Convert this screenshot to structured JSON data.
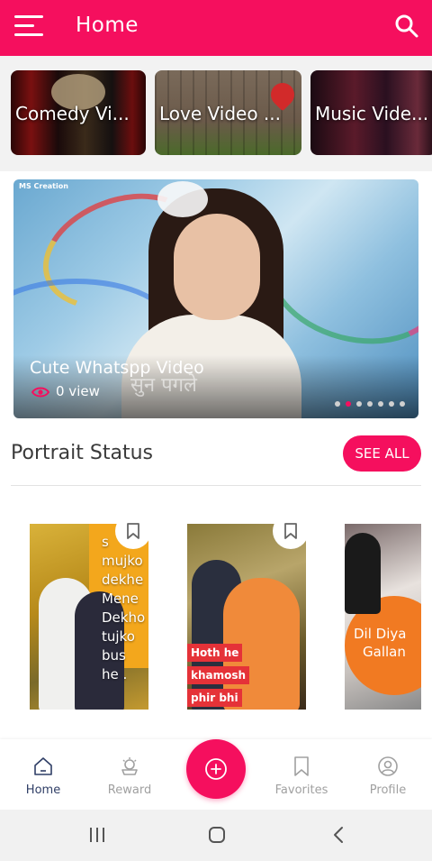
{
  "header": {
    "title": "Home"
  },
  "categories": [
    {
      "label": "Comedy Vi..."
    },
    {
      "label": "Love Video ..."
    },
    {
      "label": "Music Vide..."
    }
  ],
  "featured": {
    "credit": "MS Creation",
    "title": "Cute Whatspp Video",
    "views": "0 view",
    "overlay_text": "सुन पगले",
    "page_count": 7,
    "active_page": 2
  },
  "portrait_section": {
    "title": "Portrait Status",
    "see_all_label": "SEE ALL",
    "cards": [
      {
        "caption_lines": [
          "s",
          "mujko",
          "dekhe",
          "Mene",
          "Dekho",
          "tujko",
          "bus",
          "he ."
        ]
      },
      {
        "caption_lines": [
          "Hoth he",
          "khamosh",
          "phir bhi"
        ]
      },
      {
        "caption_lines": [
          "Dil Diya",
          "Gallan"
        ]
      }
    ]
  },
  "bottom_nav": {
    "items": [
      {
        "label": "Home",
        "icon": "home-icon",
        "active": true
      },
      {
        "label": "Reward",
        "icon": "reward-icon",
        "active": false
      },
      {
        "label": "Favorites",
        "icon": "bookmark-icon",
        "active": false
      },
      {
        "label": "Profile",
        "icon": "profile-icon",
        "active": false
      }
    ],
    "fab_icon": "add-circle-icon"
  },
  "colors": {
    "accent": "#f50f5e",
    "active_nav": "#2f3e66",
    "inactive_nav": "#a0a0a0"
  }
}
